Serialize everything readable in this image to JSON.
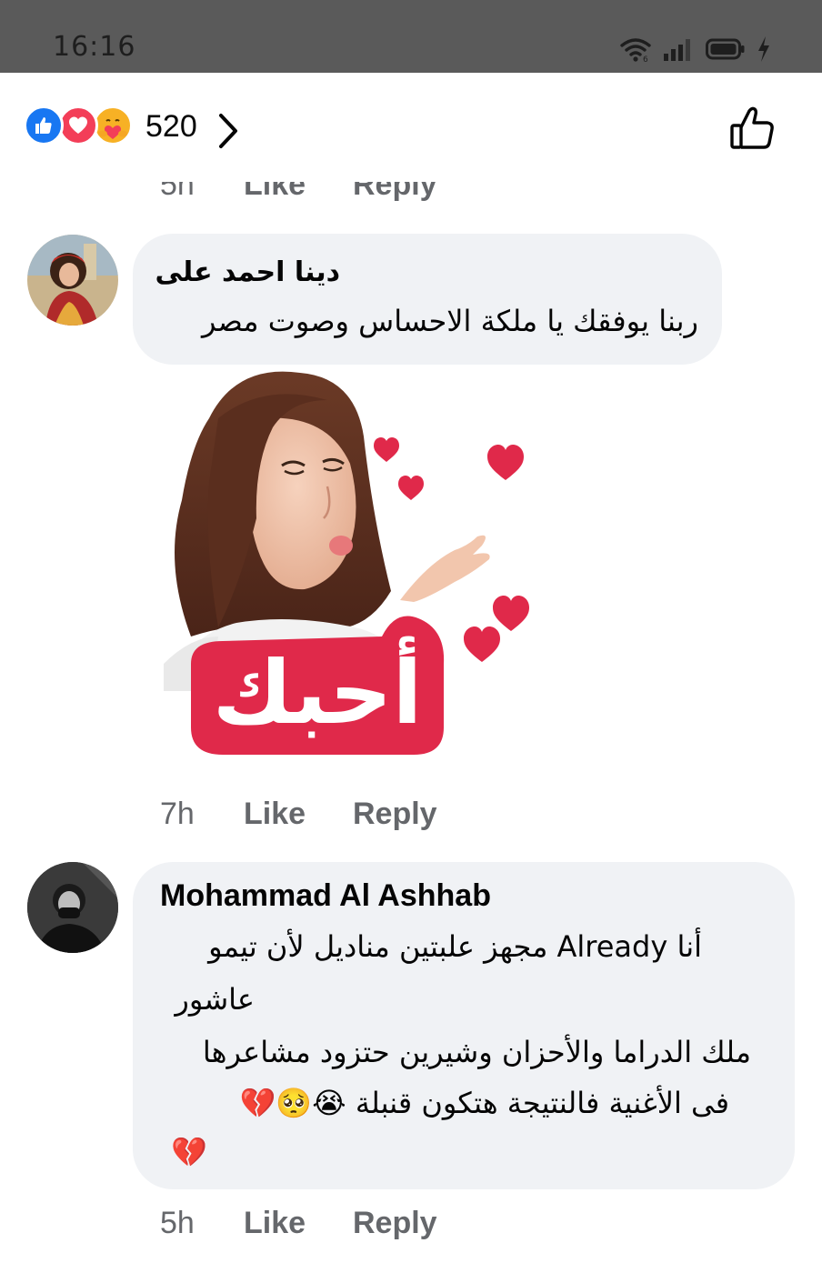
{
  "status_bar": {
    "time": "16:16",
    "icons": [
      "wifi-icon",
      "signal-icon",
      "battery-icon",
      "charging-icon"
    ]
  },
  "reactions": {
    "icons": [
      "like-reaction-icon",
      "love-reaction-icon",
      "care-reaction-icon"
    ],
    "count": "520"
  },
  "top_meta": {
    "time": "5h",
    "like": "Like",
    "reply": "Reply"
  },
  "comments": [
    {
      "author": "دينا احمد على",
      "text": "ربنا يوفقك يا ملكة الاحساس وصوت مصر",
      "sticker_text": "أحبك",
      "meta": {
        "time": "7h",
        "like": "Like",
        "reply": "Reply"
      }
    },
    {
      "author": "Mohammad Al Ashhab",
      "lines": [
        "أنا Already مجهز علبتين مناديل لأن تيمو",
        "عاشور",
        "ملك الدراما والأحزان وشيرين حتزود مشاعرها",
        "فى الأغنية فالنتيجة هتكون قنبلة 😭🥺💔",
        "💔"
      ],
      "meta": {
        "time": "5h",
        "like": "Like",
        "reply": "Reply"
      }
    }
  ],
  "colors": {
    "like_blue": "#1877f2",
    "love_red": "#f33e58",
    "care_yellow": "#f7b125",
    "bubble_bg": "#f0f2f5",
    "meta_gray": "#65676b",
    "sticker_red": "#e0294a"
  }
}
